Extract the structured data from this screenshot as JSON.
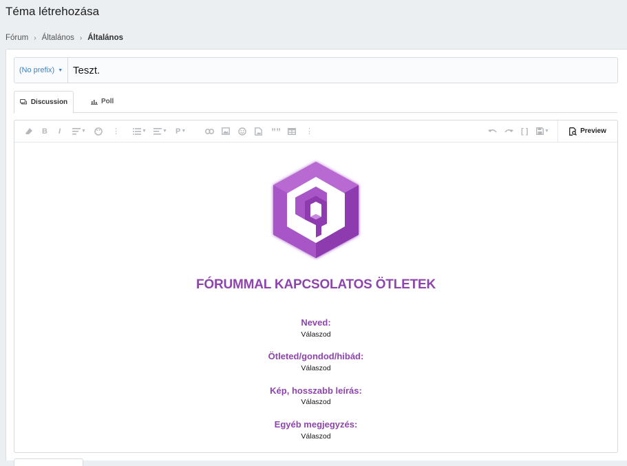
{
  "page": {
    "title": "Téma létrehozása"
  },
  "breadcrumb": {
    "items": [
      "Fórum",
      "Általános",
      "Általános"
    ]
  },
  "form": {
    "prefix_label": "(No prefix)",
    "title_value": "Teszt."
  },
  "tabs": [
    {
      "label": "Discussion",
      "active": true
    },
    {
      "label": "Poll",
      "active": false
    }
  ],
  "editor": {
    "toolbar_icons": [
      "eraser-icon",
      "bold-icon",
      "italic-icon",
      "text-options-icon",
      "color-palette-icon",
      "more-vertical-icon",
      "list-icon",
      "align-icon",
      "paragraph-icon",
      "link-icon",
      "image-icon",
      "smilie-icon",
      "media-icon",
      "quote-icon",
      "table-icon",
      "more-vertical-icon",
      "undo-icon",
      "redo-icon",
      "bbcode-toggle-icon",
      "drafts-icon"
    ],
    "preview_label": "Preview",
    "heading": "FÓRUMMAL KAPCSOLATOS ÖTLETEK",
    "fields": [
      {
        "label": "Neved:",
        "value": "Válaszod"
      },
      {
        "label": "Ötleted/gondod/hibád:",
        "value": "Válaszod"
      },
      {
        "label": "Kép, hosszabb leírás:",
        "value": "Válaszod"
      },
      {
        "label": "Egyéb megjegyzés:",
        "value": "Válaszod"
      }
    ]
  },
  "colors": {
    "accent": "#8e44ad",
    "link": "#3b82c4"
  }
}
